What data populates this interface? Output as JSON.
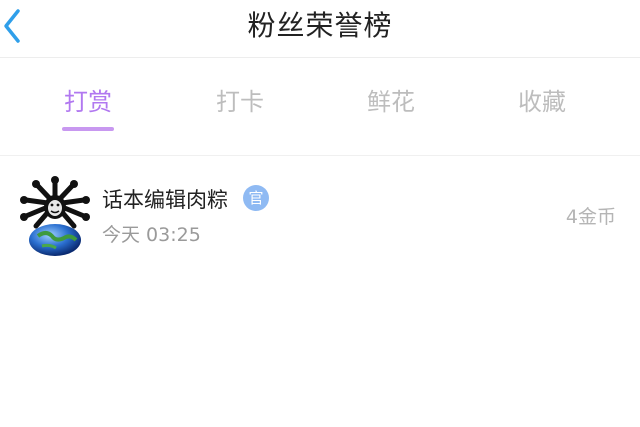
{
  "header": {
    "title": "粉丝荣誉榜",
    "back_icon": "chevron-left-icon",
    "accent_color": "#2f9fea"
  },
  "tabs": [
    {
      "label": "打赏",
      "active": true
    },
    {
      "label": "打卡",
      "active": false
    },
    {
      "label": "鲜花",
      "active": false
    },
    {
      "label": "收藏",
      "active": false
    }
  ],
  "tab_active_color": "#b178f0",
  "entries": [
    {
      "name": "话本编辑肉粽",
      "badge": "官",
      "time": "今天 03:25",
      "amount": "4金币",
      "avatar_icon": "meme-avatar-icon"
    }
  ]
}
